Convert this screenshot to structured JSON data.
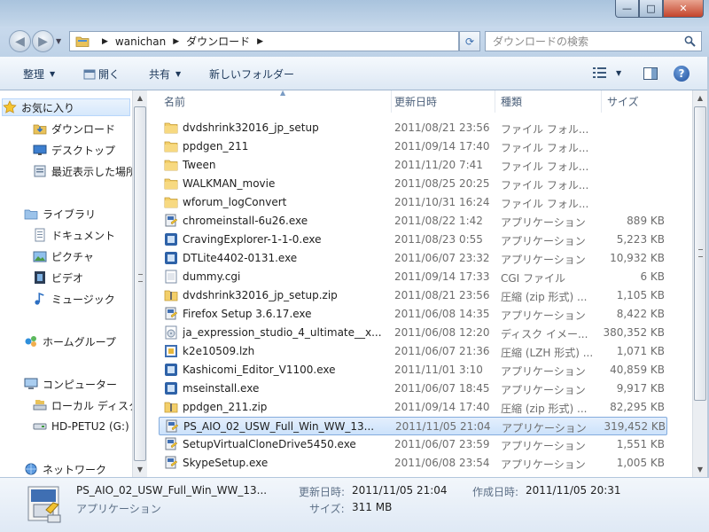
{
  "window": {
    "caption_buttons": {
      "minimize": "—",
      "maximize": "□",
      "close": "✕"
    }
  },
  "address": {
    "crumbs": [
      "wanichan",
      "ダウンロード"
    ],
    "search_placeholder": "ダウンロードの検索"
  },
  "toolbar": {
    "organize": "整理",
    "open": "開く",
    "share": "共有",
    "new_folder": "新しいフォルダー"
  },
  "nav": {
    "items": [
      {
        "label": "お気に入り",
        "icon": "star-icon"
      },
      {
        "label": "ダウンロード",
        "icon": "download-folder-icon"
      },
      {
        "label": "デスクトップ",
        "icon": "desktop-icon"
      },
      {
        "label": "最近表示した場所",
        "icon": "recent-places-icon"
      },
      {
        "label": "ライブラリ",
        "icon": "library-icon"
      },
      {
        "label": "ドキュメント",
        "icon": "documents-icon"
      },
      {
        "label": "ピクチャ",
        "icon": "pictures-icon"
      },
      {
        "label": "ビデオ",
        "icon": "videos-icon"
      },
      {
        "label": "ミュージック",
        "icon": "music-icon"
      },
      {
        "label": "ホームグループ",
        "icon": "homegroup-icon"
      },
      {
        "label": "コンピューター",
        "icon": "computer-icon"
      },
      {
        "label": "ローカル ディスク",
        "icon": "local-disk-icon"
      },
      {
        "label": "HD-PETU2 (G:)",
        "icon": "external-drive-icon"
      },
      {
        "label": "ネットワーク",
        "icon": "network-icon"
      }
    ]
  },
  "columns": {
    "name": "名前",
    "date": "更新日時",
    "type": "種類",
    "size": "サイズ"
  },
  "files": [
    {
      "name": "dvdshrink32016_jp_setup",
      "date": "2011/08/21 23:56",
      "type": "ファイル フォル...",
      "size": "",
      "icon": "folder-icon"
    },
    {
      "name": "ppdgen_211",
      "date": "2011/09/14 17:40",
      "type": "ファイル フォル...",
      "size": "",
      "icon": "folder-icon"
    },
    {
      "name": "Tween",
      "date": "2011/11/20 7:41",
      "type": "ファイル フォル...",
      "size": "",
      "icon": "folder-icon"
    },
    {
      "name": "WALKMAN_movie",
      "date": "2011/08/25 20:25",
      "type": "ファイル フォル...",
      "size": "",
      "icon": "folder-icon"
    },
    {
      "name": "wforum_logConvert",
      "date": "2011/10/31 16:24",
      "type": "ファイル フォル...",
      "size": "",
      "icon": "folder-icon"
    },
    {
      "name": "chromeinstall-6u26.exe",
      "date": "2011/08/22 1:42",
      "type": "アプリケーション",
      "size": "889 KB",
      "icon": "installer-icon"
    },
    {
      "name": "CravingExplorer-1-1-0.exe",
      "date": "2011/08/23 0:55",
      "type": "アプリケーション",
      "size": "5,223 KB",
      "icon": "app-icon"
    },
    {
      "name": "DTLite4402-0131.exe",
      "date": "2011/06/07 23:32",
      "type": "アプリケーション",
      "size": "10,932 KB",
      "icon": "app-icon"
    },
    {
      "name": "dummy.cgi",
      "date": "2011/09/14 17:33",
      "type": "CGI ファイル",
      "size": "6 KB",
      "icon": "cgi-file-icon"
    },
    {
      "name": "dvdshrink32016_jp_setup.zip",
      "date": "2011/08/21 23:56",
      "type": "圧縮 (zip 形式) ...",
      "size": "1,105 KB",
      "icon": "zip-icon"
    },
    {
      "name": "Firefox Setup 3.6.17.exe",
      "date": "2011/06/08 14:35",
      "type": "アプリケーション",
      "size": "8,422 KB",
      "icon": "installer-icon"
    },
    {
      "name": "ja_expression_studio_4_ultimate__x...",
      "date": "2011/06/08 12:20",
      "type": "ディスク イメー...",
      "size": "380,352 KB",
      "icon": "disc-image-icon"
    },
    {
      "name": "k2e10509.lzh",
      "date": "2011/06/07 21:36",
      "type": "圧縮 (LZH 形式) ...",
      "size": "1,071 KB",
      "icon": "lzh-icon"
    },
    {
      "name": "Kashicomi_Editor_V1100.exe",
      "date": "2011/11/01 3:10",
      "type": "アプリケーション",
      "size": "40,859 KB",
      "icon": "app-icon"
    },
    {
      "name": "mseinstall.exe",
      "date": "2011/06/07 18:45",
      "type": "アプリケーション",
      "size": "9,917 KB",
      "icon": "app-icon"
    },
    {
      "name": "ppdgen_211.zip",
      "date": "2011/09/14 17:40",
      "type": "圧縮 (zip 形式) ...",
      "size": "82,295 KB",
      "icon": "zip-icon"
    },
    {
      "name": "PS_AIO_02_USW_Full_Win_WW_13...",
      "date": "2011/11/05 21:04",
      "type": "アプリケーション",
      "size": "319,452 KB",
      "icon": "installer-icon",
      "selected": true
    },
    {
      "name": "SetupVirtualCloneDrive5450.exe",
      "date": "2011/06/07 23:59",
      "type": "アプリケーション",
      "size": "1,551 KB",
      "icon": "installer-icon"
    },
    {
      "name": "SkypeSetup.exe",
      "date": "2011/06/08 23:54",
      "type": "アプリケーション",
      "size": "1,005 KB",
      "icon": "installer-icon"
    }
  ],
  "details": {
    "name": "PS_AIO_02_USW_Full_Win_WW_13...",
    "type": "アプリケーション",
    "modified_label": "更新日時:",
    "modified_value": "2011/11/05 21:04",
    "created_label": "作成日時:",
    "created_value": "2011/11/05 20:31",
    "size_label": "サイズ:",
    "size_value": "311 MB"
  },
  "colors": {
    "selection": "#cce2fb",
    "selection_border": "#84acdd",
    "folder": "#f3cf6a",
    "chrome": "#c5d7ea"
  }
}
